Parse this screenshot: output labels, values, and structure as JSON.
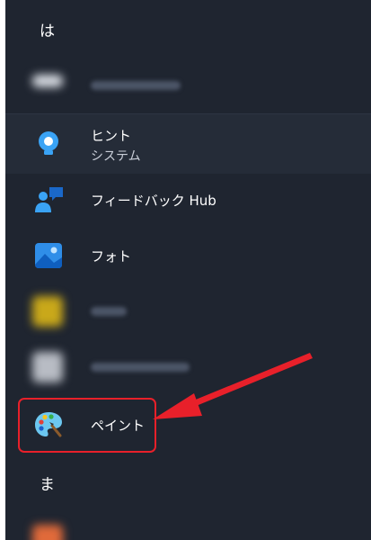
{
  "start_menu": {
    "sections": [
      {
        "header": "は"
      },
      {
        "header": "ま"
      }
    ],
    "apps": [
      {
        "label": "ヒント",
        "subtitle": "システム",
        "icon": "lightbulb-icon"
      },
      {
        "label": "フィードバック Hub",
        "icon": "feedback-hub-icon"
      },
      {
        "label": "フォト",
        "icon": "photos-icon"
      },
      {
        "label": "ペイント",
        "icon": "paint-palette-icon"
      }
    ]
  },
  "annotation": {
    "highlight_color": "#e8202a",
    "arrow_color": "#e8202a"
  },
  "colors": {
    "panel_bg": "#1f2530",
    "accent_blue": "#3aa3f5"
  }
}
